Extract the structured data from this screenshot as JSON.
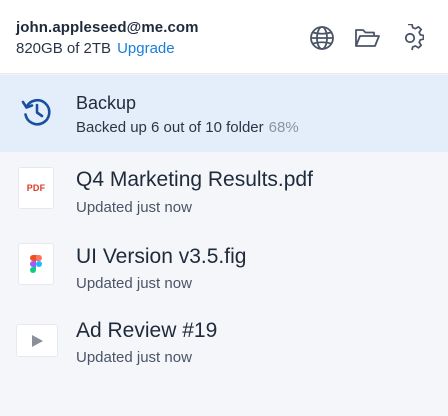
{
  "account": {
    "email": "john.appleseed@me.com",
    "storage": "820GB of 2TB",
    "upgrade_label": "Upgrade"
  },
  "toolbar": {
    "icons": [
      "globe-icon",
      "folder-icon",
      "gear-icon"
    ]
  },
  "backup": {
    "title": "Backup",
    "status": "Backed up 6 out of 10 folder",
    "percent": "68%",
    "progress": 0.68
  },
  "files": [
    {
      "name": "Q4 Marketing Results.pdf",
      "status": "Updated just now",
      "thumb": "PDF"
    },
    {
      "name": "UI Version v3.5.fig",
      "status": "Updated just now",
      "thumb": "figma-icon"
    },
    {
      "name": "Ad Review #19",
      "status": "Updated just now",
      "thumb": "play-icon"
    }
  ],
  "colors": {
    "accent": "#1a7fd8",
    "header_bg": "#ffffff",
    "selected_row_bg": "#e3eefa",
    "pdf_red": "#d93a2b"
  }
}
